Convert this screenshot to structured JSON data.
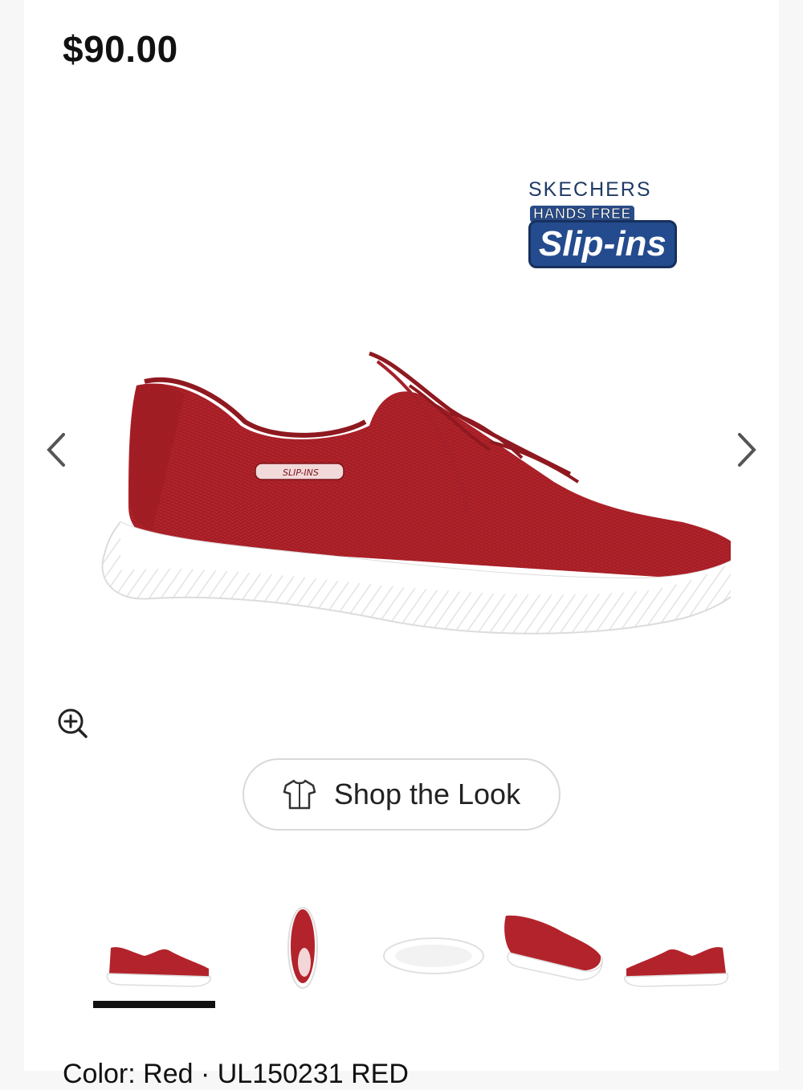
{
  "product": {
    "price": "$90.00"
  },
  "brand_badge": {
    "brand": "SKECHERS",
    "sub": "HANDS FREE",
    "line": "Slip-ins"
  },
  "gallery": {
    "main_image": "red knit slip-on sneaker, side view",
    "prev_icon": "chevron-left-icon",
    "next_icon": "chevron-right-icon",
    "zoom_icon": "zoom-in-icon",
    "thumbnails": [
      {
        "view": "side",
        "selected": true
      },
      {
        "view": "top"
      },
      {
        "view": "sole"
      },
      {
        "view": "front-angle"
      },
      {
        "view": "side-alt"
      }
    ]
  },
  "actions": {
    "shop_the_look_label": "Shop the Look",
    "shop_the_look_icon": "tshirt-icon"
  },
  "details": {
    "color_line": "Color: Red · UL150231 RED"
  },
  "colors": {
    "shoe_red": "#b3232b",
    "sole_white": "#ffffff",
    "brand_blue": "#1f3a66"
  }
}
